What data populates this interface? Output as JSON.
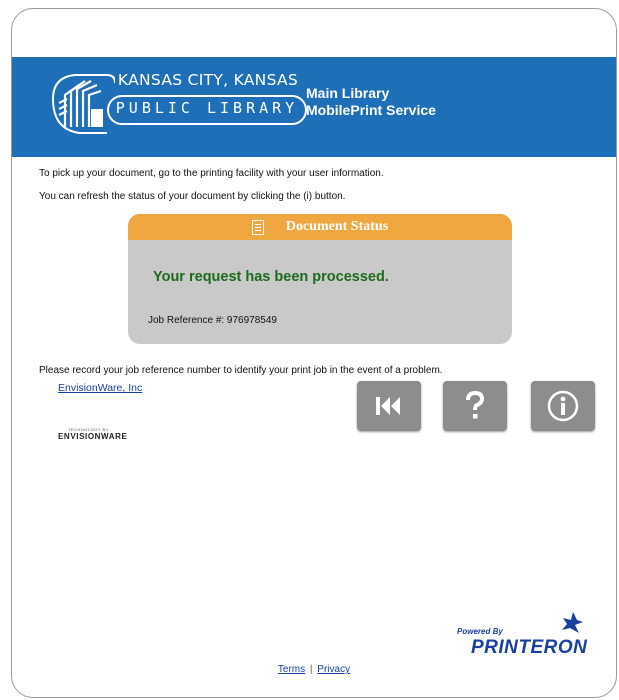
{
  "banner": {
    "logo_line1": "KANSAS CITY, KANSAS",
    "logo_line2": "PUBLIC LIBRARY",
    "title_line1": "Main Library",
    "title_line2": "MobilePrint Service",
    "bg_color": "#1f6fb8"
  },
  "instructions": {
    "line1": "To pick up your document, go to the printing facility with your user information.",
    "line2": "You can refresh the status of your document by clicking the (i) button."
  },
  "status": {
    "header": "Document Status",
    "header_icon": "document-icon",
    "message": "Your request has been processed.",
    "job_ref_label": "Job Reference #: 976978549",
    "header_color": "#f0a740",
    "message_color": "#1c6b1c"
  },
  "record_note": "Please record your job reference number to identify your print job in the event of a problem.",
  "envisionware": {
    "link": "EnvisionWare, Inc",
    "logo_small": "TECHNOLOGY BY",
    "logo_big": "ENVISIONWARE"
  },
  "buttons": [
    {
      "name": "back-button",
      "icon": "rewind-icon"
    },
    {
      "name": "help-button",
      "icon": "question-icon"
    },
    {
      "name": "info-button",
      "icon": "info-icon"
    }
  ],
  "powered": {
    "label": "Powered By",
    "brand": "PRINTERON"
  },
  "footer": {
    "terms": "Terms",
    "separator": "|",
    "privacy": "Privacy"
  }
}
